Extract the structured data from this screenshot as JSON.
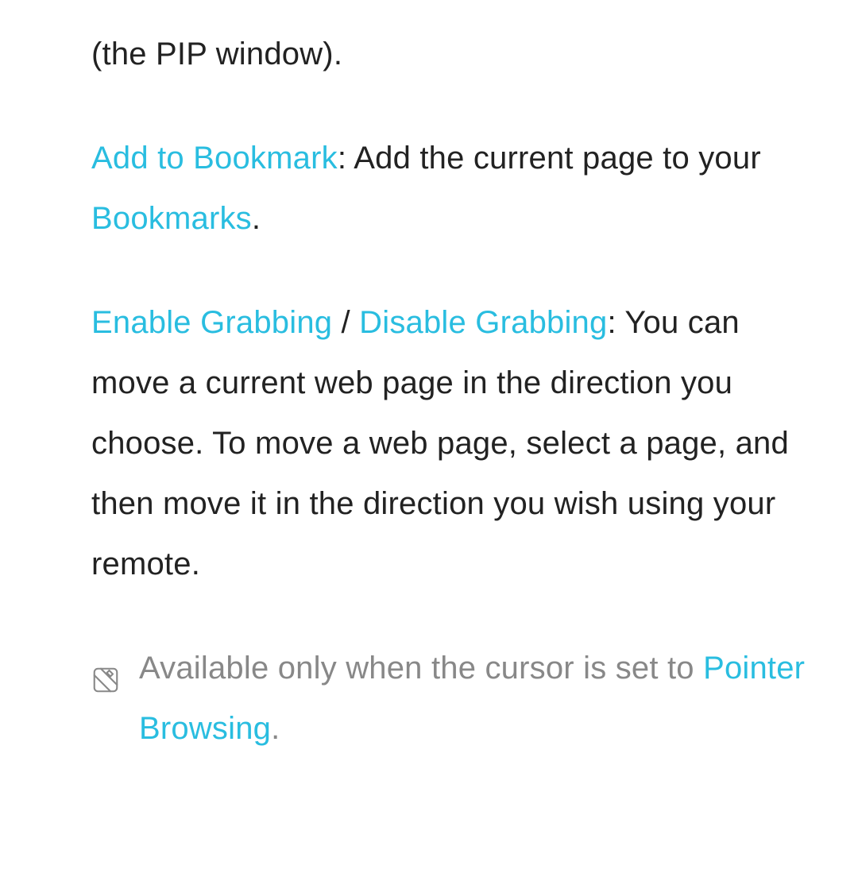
{
  "p0": {
    "text": "(the PIP window)."
  },
  "p1": {
    "link1": "Add to Bookmark",
    "frag1": ": Add the current page to your ",
    "link2": "Bookmarks",
    "frag2": "."
  },
  "p2": {
    "link1": "Enable Grabbing",
    "sep": " / ",
    "link2": "Disable Grabbing",
    "frag": ": You can move a current web page in the direction you choose. To move a web page, select a page, and then move it in the direction you wish using your remote."
  },
  "note": {
    "frag1": "Available only when the cursor is set to ",
    "link": "Pointer Browsing",
    "frag2": "."
  }
}
